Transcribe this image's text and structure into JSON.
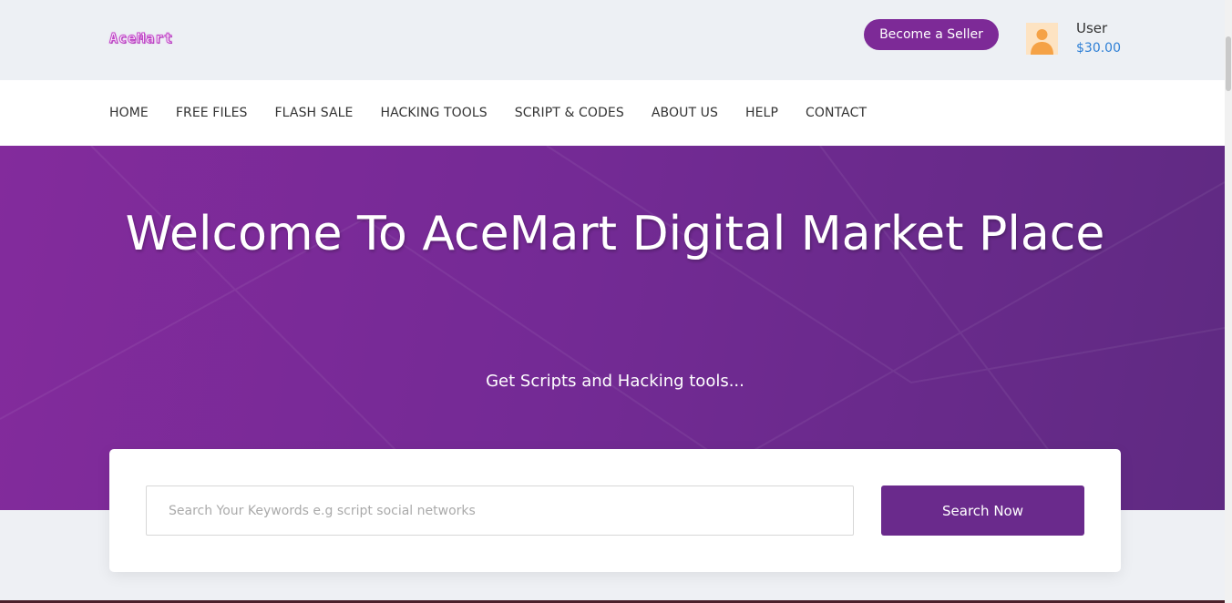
{
  "header": {
    "logo_text": "AceMart",
    "seller_button": "Become a Seller",
    "user": {
      "avatar_icon": "user-avatar-icon",
      "name": "User",
      "balance": "$30.00"
    }
  },
  "nav": {
    "items": [
      {
        "label": "HOME"
      },
      {
        "label": "FREE FILES"
      },
      {
        "label": "FLASH SALE"
      },
      {
        "label": "HACKING TOOLS"
      },
      {
        "label": "SCRIPT & CODES"
      },
      {
        "label": "ABOUT US"
      },
      {
        "label": "HELP"
      },
      {
        "label": "CONTACT"
      }
    ]
  },
  "hero": {
    "title": "Welcome To AceMart Digital Market Place",
    "subtitle": "Get Scripts and Hacking tools..."
  },
  "search": {
    "placeholder": "Search Your Keywords e.g script social networks",
    "value": "",
    "button": "Search Now"
  },
  "colors": {
    "brand_purple": "#7d2a97",
    "hero_gradient_start": "#832b9c",
    "hero_gradient_end": "#5f2a82",
    "search_button": "#6a2a8c",
    "balance_blue": "#2f80d6",
    "page_bg": "#eef0f4"
  }
}
